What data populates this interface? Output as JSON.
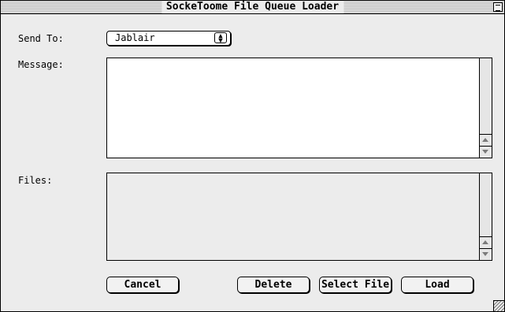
{
  "window": {
    "title": "SockeToome File Queue Loader"
  },
  "form": {
    "send_to": {
      "label": "Send To:",
      "selected": "Jablair"
    },
    "message": {
      "label": "Message:",
      "value": ""
    },
    "files": {
      "label": "Files:",
      "value": ""
    }
  },
  "buttons": {
    "cancel": "Cancel",
    "delete": "Delete",
    "select_file": "Select File",
    "load": "Load"
  },
  "icons": {
    "popup_arrow": "up-down-arrow-icon",
    "scroll_up": "scroll-up-arrow-icon",
    "scroll_down": "scroll-down-arrow-icon",
    "zoom": "zoom-box-icon",
    "resize": "resize-grip-icon"
  }
}
